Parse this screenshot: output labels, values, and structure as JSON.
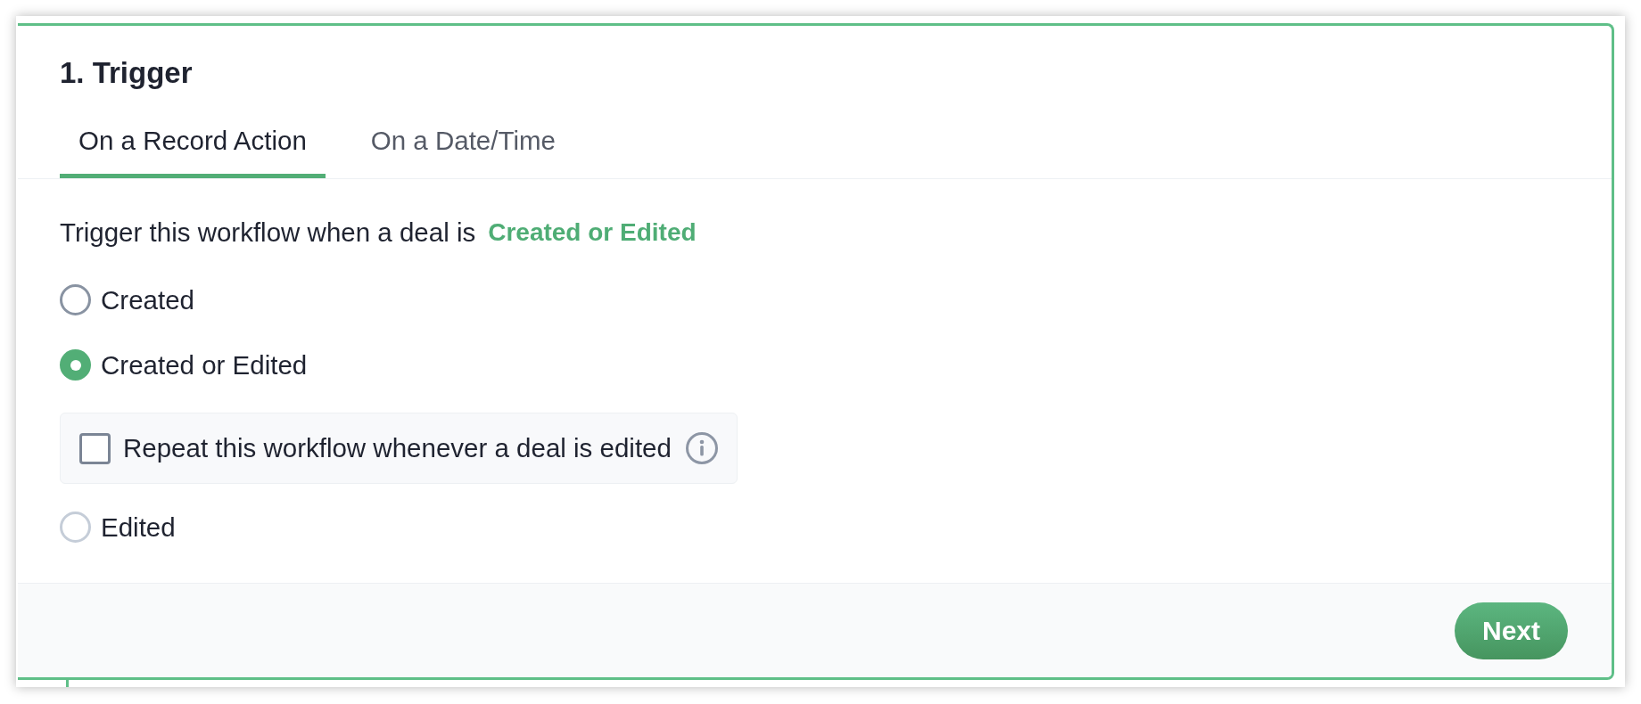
{
  "card": {
    "title": "1. Trigger"
  },
  "tabs": [
    {
      "label": "On a Record Action",
      "selected": true
    },
    {
      "label": "On a Date/Time",
      "selected": false
    }
  ],
  "prompt": {
    "text": "Trigger this workflow when a deal is",
    "value": "Created or Edited"
  },
  "options": [
    {
      "label": "Created",
      "selected": false,
      "hovered": true
    },
    {
      "label": "Created or Edited",
      "selected": true,
      "hovered": false,
      "repeat_option": {
        "label": "Repeat this workflow whenever a deal is edited",
        "checked": false
      }
    },
    {
      "label": "Edited",
      "selected": false,
      "hovered": false
    }
  ],
  "footer": {
    "button": "Next"
  }
}
